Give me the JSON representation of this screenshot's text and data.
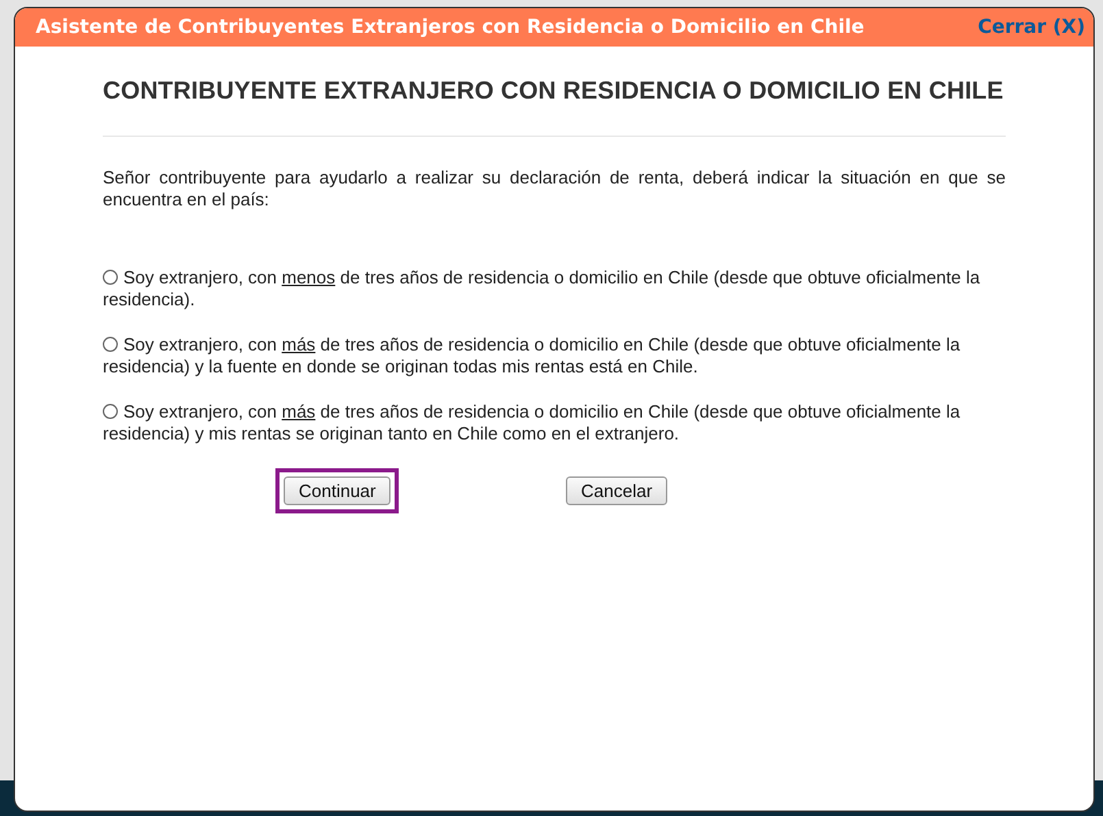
{
  "dialog": {
    "title": "Asistente de Contribuyentes Extranjeros con Residencia o Domicilio en Chile",
    "close_link": "Cerrar (X)"
  },
  "heading": "CONTRIBUYENTE EXTRANJERO CON RESIDENCIA O DOMICILIO EN CHILE",
  "intro": "Señor contribuyente para ayudarlo a realizar su declaración de renta, deberá indicar la situación en que se encuentra en el país:",
  "options": [
    {
      "selected": false,
      "parts": [
        {
          "text": "Soy extranjero, con ",
          "underline": false
        },
        {
          "text": "menos",
          "underline": true
        },
        {
          "text": " de tres años de residencia o domicilio en Chile (desde que obtuve oficialmente la residencia).",
          "underline": false
        }
      ]
    },
    {
      "selected": false,
      "parts": [
        {
          "text": "Soy extranjero, con ",
          "underline": false
        },
        {
          "text": "más",
          "underline": true
        },
        {
          "text": " de tres años de residencia o domicilio en Chile (desde que obtuve oficialmente la residencia) y la fuente en donde se originan todas mis rentas está en Chile.",
          "underline": false
        }
      ]
    },
    {
      "selected": false,
      "parts": [
        {
          "text": "Soy extranjero, con ",
          "underline": false
        },
        {
          "text": "más",
          "underline": true
        },
        {
          "text": " de tres años de residencia o domicilio en Chile (desde que obtuve oficialmente la residencia) y mis rentas se originan tanto en Chile como en el extranjero.",
          "underline": false
        }
      ]
    }
  ],
  "buttons": [
    {
      "label": "Continuar",
      "highlighted": true
    },
    {
      "label": "Cancelar",
      "highlighted": false
    }
  ]
}
